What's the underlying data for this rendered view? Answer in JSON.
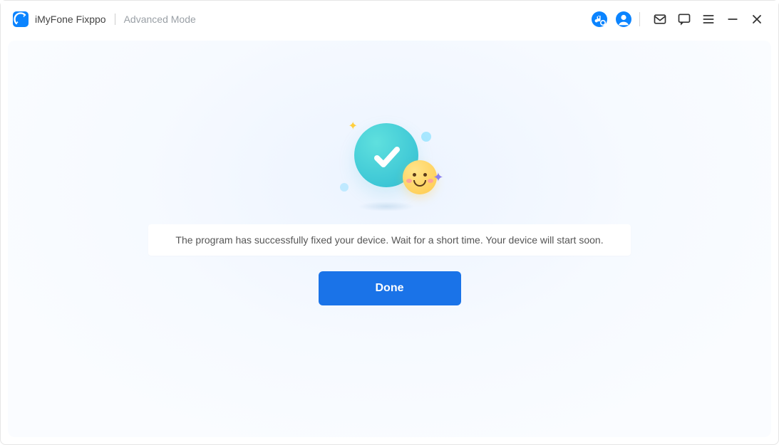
{
  "titlebar": {
    "app_name": "iMyFone Fixppo",
    "mode": "Advanced Mode",
    "icons": {
      "music": "music-search-icon",
      "account": "account-icon",
      "mail": "mail-icon",
      "chat": "chat-icon",
      "menu": "menu-icon",
      "minimize": "minimize-icon",
      "close": "close-icon"
    }
  },
  "main": {
    "status_message": "The program has successfully fixed your device. Wait for a short time. Your device will start soon.",
    "done_label": "Done"
  },
  "colors": {
    "primary_button": "#1a73e8",
    "accent_blue": "#0b84ff"
  }
}
